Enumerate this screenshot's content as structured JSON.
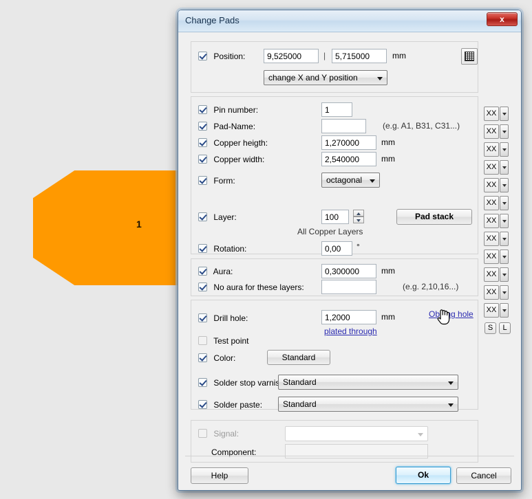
{
  "window": {
    "title": "Change Pads",
    "close_label": "x"
  },
  "canvas": {
    "pad_label": "1",
    "pad_color": "#ff9900",
    "background_color": "#e8e8e8"
  },
  "position": {
    "label": "Position:",
    "checked": true,
    "x_value": "9,525000",
    "separator": "|",
    "y_value": "5,715000",
    "unit": "mm",
    "mode": "change X and Y position",
    "grid_icon": "grid-icon"
  },
  "properties": {
    "pin_number": {
      "label": "Pin number:",
      "checked": true,
      "value": "1"
    },
    "pad_name": {
      "label": "Pad-Name:",
      "checked": true,
      "value": "",
      "hint": "(e.g. A1, B31, C31...)"
    },
    "copper_height": {
      "label": "Copper heigth:",
      "checked": true,
      "value": "1,270000",
      "unit": "mm"
    },
    "copper_width": {
      "label": "Copper width:",
      "checked": true,
      "value": "2,540000",
      "unit": "mm"
    },
    "form": {
      "label": "Form:",
      "checked": true,
      "value": "octagonal"
    }
  },
  "layer": {
    "label": "Layer:",
    "checked": true,
    "value": "100",
    "sub_label": "All Copper Layers",
    "pad_stack_button": "Pad stack"
  },
  "rotation": {
    "label": "Rotation:",
    "checked": true,
    "value": "0,00",
    "unit": "°"
  },
  "aura": {
    "label": "Aura:",
    "checked": true,
    "value": "0,300000",
    "unit": "mm",
    "no_aura_label": "No aura for these layers:",
    "no_aura_checked": true,
    "no_aura_value": "",
    "no_aura_hint": "(e.g. 2,10,16...)"
  },
  "drill": {
    "label": "Drill hole:",
    "checked": true,
    "value": "1,2000",
    "unit": "mm",
    "plated_link": "plated through",
    "oblong_link": "Oblong hole"
  },
  "test_point": {
    "label": "Test point",
    "checked": false
  },
  "color": {
    "label": "Color:",
    "checked": true,
    "button": "Standard"
  },
  "solder_stop": {
    "label": "Solder stop varnish:",
    "checked": true,
    "value": "Standard"
  },
  "solder_paste": {
    "label": "Solder paste:",
    "checked": true,
    "value": "Standard"
  },
  "signal": {
    "label": "Signal:",
    "checked": false,
    "disabled": true,
    "value": "",
    "component_label": "Component:",
    "component_value": ""
  },
  "layer_buttons": {
    "items": [
      "XX",
      "XX",
      "XX",
      "XX",
      "XX",
      "XX",
      "XX",
      "XX",
      "XX",
      "XX",
      "XX",
      "XX"
    ],
    "small": [
      "S",
      "L"
    ]
  },
  "footer": {
    "help": "Help",
    "ok": "Ok",
    "cancel": "Cancel"
  }
}
